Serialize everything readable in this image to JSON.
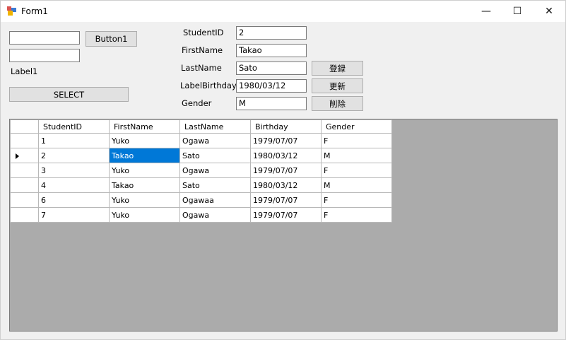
{
  "window": {
    "title": "Form1",
    "minimize_glyph": "—",
    "maximize_glyph": "☐",
    "close_glyph": "✕"
  },
  "left_panel": {
    "textbox1_value": "",
    "textbox2_value": "",
    "button1_label": "Button1",
    "label1_text": "Label1",
    "select_label": "SELECT"
  },
  "form": {
    "fields": [
      {
        "label": "StudentID",
        "value": "2"
      },
      {
        "label": "FirstName",
        "value": "Takao"
      },
      {
        "label": "LastName",
        "value": "Sato"
      },
      {
        "label": "LabelBirthday",
        "value": "1980/03/12"
      },
      {
        "label": "Gender",
        "value": "M"
      }
    ],
    "register_label": "登録",
    "update_label": "更新",
    "delete_label": "削除"
  },
  "grid": {
    "columns": [
      "StudentID",
      "FirstName",
      "LastName",
      "Birthday",
      "Gender"
    ],
    "rows": [
      [
        "1",
        "Yuko",
        "Ogawa",
        "1979/07/07",
        "F"
      ],
      [
        "2",
        "Takao",
        "Sato",
        "1980/03/12",
        "M"
      ],
      [
        "3",
        "Yuko",
        "Ogawa",
        "1979/07/07",
        "F"
      ],
      [
        "4",
        "Takao",
        "Sato",
        "1980/03/12",
        "M"
      ],
      [
        "6",
        "Yuko",
        "Ogawaa",
        "1979/07/07",
        "F"
      ],
      [
        "7",
        "Yuko",
        "Ogawa",
        "1979/07/07",
        "F"
      ]
    ],
    "current_row_index": 1,
    "selected_cell": {
      "row": 1,
      "col": 1
    },
    "selection_color": "#0078d7",
    "background_color": "#ababab"
  }
}
